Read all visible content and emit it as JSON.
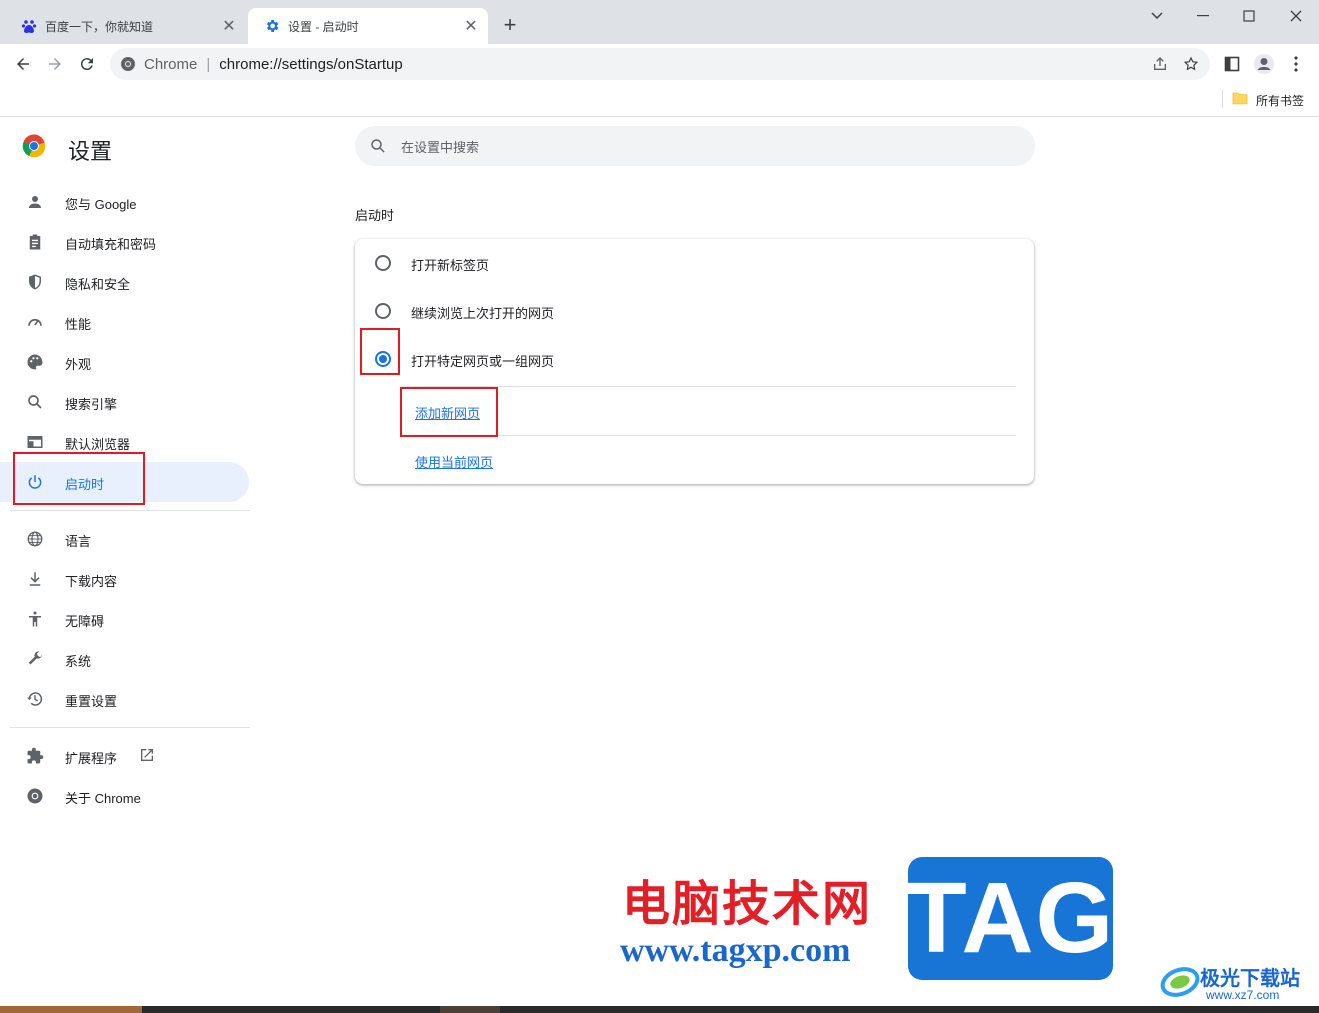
{
  "tabs": [
    {
      "title": "百度一下，你就知道",
      "icon": "baidu-icon"
    },
    {
      "title": "设置 - 启动时",
      "icon": "gear-icon"
    }
  ],
  "omnibox": {
    "site": "Chrome",
    "separator": "|",
    "url": "chrome://settings/onStartup"
  },
  "bookmarks": {
    "all_label": "所有书签"
  },
  "settings": {
    "title": "设置",
    "search_placeholder": "在设置中搜索"
  },
  "sidebar": {
    "items": [
      {
        "label": "您与 Google",
        "icon": "person-icon"
      },
      {
        "label": "自动填充和密码",
        "icon": "clipboard-icon"
      },
      {
        "label": "隐私和安全",
        "icon": "shield-icon"
      },
      {
        "label": "性能",
        "icon": "speedometer-icon"
      },
      {
        "label": "外观",
        "icon": "palette-icon"
      },
      {
        "label": "搜索引擎",
        "icon": "search-icon"
      },
      {
        "label": "默认浏览器",
        "icon": "browser-icon"
      },
      {
        "label": "启动时",
        "icon": "power-icon",
        "active": true
      },
      {
        "label": "语言",
        "icon": "globe-icon"
      },
      {
        "label": "下载内容",
        "icon": "download-icon"
      },
      {
        "label": "无障碍",
        "icon": "accessibility-icon"
      },
      {
        "label": "系统",
        "icon": "wrench-icon"
      },
      {
        "label": "重置设置",
        "icon": "history-icon"
      },
      {
        "label": "扩展程序",
        "icon": "puzzle-icon"
      },
      {
        "label": "关于 Chrome",
        "icon": "chrome-icon"
      }
    ]
  },
  "main": {
    "section_title": "启动时",
    "options": [
      {
        "label": "打开新标签页",
        "selected": false
      },
      {
        "label": "继续浏览上次打开的网页",
        "selected": false
      },
      {
        "label": "打开特定网页或一组网页",
        "selected": true
      }
    ],
    "add_page_link": "添加新网页",
    "use_current_link": "使用当前网页"
  },
  "watermark": {
    "site_name": "电脑技术网",
    "site_url": "www.tagxp.com",
    "tag": "TAG",
    "badge_name": "极光下载站",
    "badge_url": "www.xz7.com"
  },
  "colors": {
    "accent": "#1a73e8",
    "highlight": "#e01b24",
    "active_bg": "#e8f0fe"
  }
}
